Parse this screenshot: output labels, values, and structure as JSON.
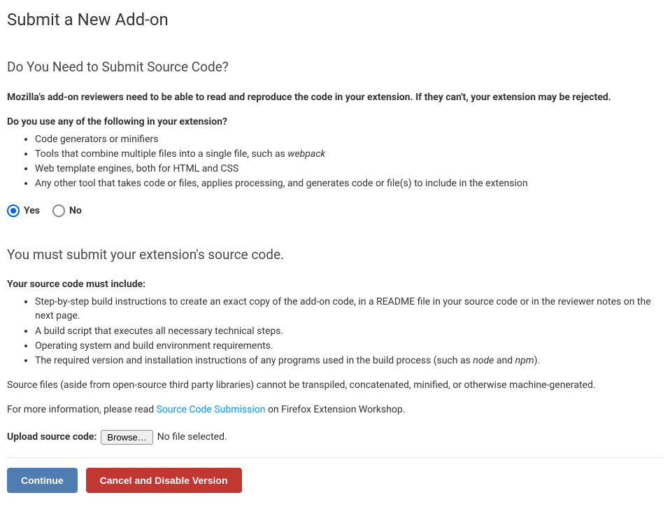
{
  "page": {
    "title": "Submit a New Add-on"
  },
  "section_source_code_q": {
    "heading": "Do You Need to Submit Source Code?",
    "intro": "Mozilla's add-on reviewers need to be able to read and reproduce the code in your extension. If they can't, your extension may be rejected.",
    "question": "Do you use any of the following in your extension?",
    "items": {
      "0": "Code generators or minifiers",
      "1_pre": "Tools that combine multiple files into a single file, such as ",
      "1_em": "webpack",
      "2": "Web template engines, both for HTML and CSS",
      "3": "Any other tool that takes code or files, applies processing, and generates code or file(s) to include in the extension"
    },
    "radios": {
      "yes": "Yes",
      "no": "No"
    }
  },
  "section_must_submit": {
    "heading": "You must submit your extension's source code.",
    "must_include": "Your source code must include:",
    "items": {
      "0": "Step-by-step build instructions to create an exact copy of the add-on code, in a README file in your source code or in the reviewer notes on the next page.",
      "1": "A build script that executes all necessary technical steps.",
      "2": "Operating system and build environment requirements.",
      "3_pre": "The required version and installation instructions of any programs used in the build process (such as ",
      "3_em1": "node",
      "3_mid": " and ",
      "3_em2": "npm",
      "3_post": ")."
    },
    "note": "Source files (aside from open-source third party libraries) cannot be transpiled, concatenated, minified, or otherwise machine-generated.",
    "info_pre": "For more information, please read ",
    "info_link": "Source Code Submission",
    "info_post": " on Firefox Extension Workshop."
  },
  "upload": {
    "label": "Upload source code:",
    "browse": "Browse…",
    "status": "No file selected."
  },
  "buttons": {
    "continue": "Continue",
    "cancel": "Cancel and Disable Version"
  }
}
